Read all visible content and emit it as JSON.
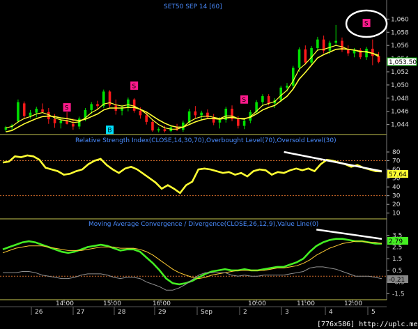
{
  "chart_data": [
    {
      "type": "candlestick",
      "title": "SET50 SEP 14",
      "title_period": "[60]",
      "yticks": [
        "1,060",
        "1,058",
        "1,056",
        "1,054",
        "1,052",
        "1,050",
        "1,048",
        "1,046",
        "1,044"
      ],
      "ylim": [
        1042.8,
        1061.2
      ],
      "last_price_label": "1,053.50",
      "last_price": 1053.5,
      "colors": {
        "up": "#00e000",
        "down": "#ff1a1a",
        "ma": "#ffff33",
        "signal_s": "#ff1a8c",
        "signal_b": "#00e0ff"
      },
      "candles": [
        [
          1043.2,
          1043.8,
          1042.9,
          1043.6
        ],
        [
          1043.6,
          1044.1,
          1043.2,
          1043.9
        ],
        [
          1044.5,
          1047.8,
          1044.2,
          1047.4
        ],
        [
          1047.2,
          1047.5,
          1044.8,
          1045.3
        ],
        [
          1045.3,
          1046.2,
          1044.9,
          1045.8
        ],
        [
          1045.8,
          1046.7,
          1045.1,
          1046.4
        ],
        [
          1046.3,
          1047.2,
          1045.8,
          1045.9
        ],
        [
          1045.9,
          1046.5,
          1044.1,
          1044.8
        ],
        [
          1044.8,
          1045.6,
          1043.5,
          1044.2
        ],
        [
          1044.2,
          1045.1,
          1043.4,
          1044.6
        ],
        [
          1044.6,
          1045.9,
          1044.0,
          1044.1
        ],
        [
          1044.1,
          1044.9,
          1043.2,
          1043.7
        ],
        [
          1043.7,
          1045.2,
          1043.3,
          1044.9
        ],
        [
          1044.9,
          1046.5,
          1044.5,
          1046.2
        ],
        [
          1046.2,
          1047.4,
          1045.6,
          1047.1
        ],
        [
          1047.1,
          1047.6,
          1046.2,
          1046.8
        ],
        [
          1046.8,
          1049.3,
          1046.5,
          1049.0
        ],
        [
          1049.0,
          1049.2,
          1046.6,
          1046.9
        ],
        [
          1046.9,
          1047.8,
          1045.5,
          1046.1
        ],
        [
          1046.1,
          1047.0,
          1045.4,
          1046.6
        ],
        [
          1046.6,
          1048.1,
          1046.0,
          1047.8
        ],
        [
          1047.8,
          1048.0,
          1045.8,
          1046.1
        ],
        [
          1046.1,
          1046.6,
          1044.9,
          1045.4
        ],
        [
          1045.4,
          1045.8,
          1044.0,
          1044.4
        ],
        [
          1044.4,
          1044.8,
          1042.9,
          1043.1
        ],
        [
          1043.1,
          1043.6,
          1042.8,
          1043.3
        ],
        [
          1043.3,
          1043.8,
          1042.8,
          1043.0
        ],
        [
          1043.0,
          1043.9,
          1042.8,
          1043.6
        ],
        [
          1043.6,
          1044.1,
          1043.0,
          1043.2
        ],
        [
          1043.2,
          1044.6,
          1042.9,
          1044.3
        ],
        [
          1044.3,
          1046.4,
          1044.1,
          1046.0
        ],
        [
          1046.0,
          1046.8,
          1045.0,
          1045.4
        ],
        [
          1045.4,
          1046.1,
          1044.6,
          1045.8
        ],
        [
          1045.8,
          1046.3,
          1044.9,
          1045.1
        ],
        [
          1045.1,
          1045.6,
          1043.9,
          1044.3
        ],
        [
          1044.3,
          1045.1,
          1043.4,
          1044.7
        ],
        [
          1044.7,
          1046.7,
          1044.3,
          1046.4
        ],
        [
          1046.4,
          1046.9,
          1044.5,
          1044.8
        ],
        [
          1044.8,
          1045.3,
          1043.4,
          1043.8
        ],
        [
          1043.8,
          1045.0,
          1043.3,
          1044.6
        ],
        [
          1044.6,
          1046.2,
          1044.2,
          1045.9
        ],
        [
          1045.9,
          1047.7,
          1045.6,
          1047.4
        ],
        [
          1047.4,
          1048.6,
          1047.0,
          1048.3
        ],
        [
          1048.3,
          1048.6,
          1046.9,
          1047.2
        ],
        [
          1047.2,
          1048.0,
          1046.5,
          1047.7
        ],
        [
          1047.7,
          1049.9,
          1047.4,
          1049.6
        ],
        [
          1049.6,
          1050.3,
          1049.0,
          1049.9
        ],
        [
          1049.9,
          1052.9,
          1049.5,
          1052.6
        ],
        [
          1052.6,
          1055.7,
          1052.0,
          1055.4
        ],
        [
          1055.4,
          1056.0,
          1053.1,
          1053.4
        ],
        [
          1053.4,
          1055.9,
          1053.0,
          1055.6
        ],
        [
          1055.6,
          1057.3,
          1055.2,
          1056.9
        ],
        [
          1056.9,
          1057.5,
          1054.8,
          1055.2
        ],
        [
          1055.2,
          1056.7,
          1054.7,
          1056.4
        ],
        [
          1056.4,
          1059.1,
          1055.9,
          1056.7
        ],
        [
          1056.7,
          1057.2,
          1055.0,
          1055.3
        ],
        [
          1055.3,
          1056.0,
          1054.4,
          1054.8
        ],
        [
          1054.8,
          1055.6,
          1054.2,
          1055.3
        ],
        [
          1055.3,
          1055.6,
          1053.9,
          1054.2
        ],
        [
          1054.2,
          1055.8,
          1053.8,
          1055.5
        ],
        [
          1055.5,
          1056.9,
          1053.0,
          1054.4
        ],
        [
          1054.4,
          1055.0,
          1053.3,
          1053.5
        ]
      ],
      "ma_fast": [
        1043.5,
        1043.7,
        1044.4,
        1044.9,
        1045.2,
        1045.6,
        1045.8,
        1045.5,
        1045.0,
        1044.7,
        1044.6,
        1044.3,
        1044.4,
        1045.0,
        1045.8,
        1046.3,
        1047.1,
        1047.3,
        1047.0,
        1046.8,
        1047.0,
        1046.8,
        1046.3,
        1045.6,
        1044.7,
        1044.0,
        1043.5,
        1043.3,
        1043.3,
        1043.6,
        1044.4,
        1044.9,
        1045.2,
        1045.3,
        1045.1,
        1044.9,
        1045.3,
        1045.3,
        1044.9,
        1044.8,
        1045.2,
        1046.0,
        1046.9,
        1047.2,
        1047.5,
        1048.4,
        1049.2,
        1050.6,
        1052.4,
        1053.2,
        1054.2,
        1055.3,
        1055.4,
        1055.7,
        1056.0,
        1055.8,
        1055.4,
        1055.3,
        1055.0,
        1055.1,
        1054.8,
        1054.3
      ],
      "ma_slow": [
        1042.9,
        1043.1,
        1043.6,
        1044.1,
        1044.5,
        1044.9,
        1045.2,
        1045.3,
        1045.2,
        1045.0,
        1044.9,
        1044.7,
        1044.6,
        1044.8,
        1045.2,
        1045.6,
        1046.2,
        1046.5,
        1046.5,
        1046.5,
        1046.6,
        1046.6,
        1046.3,
        1045.9,
        1045.3,
        1044.7,
        1044.2,
        1043.8,
        1043.6,
        1043.6,
        1044.0,
        1044.4,
        1044.7,
        1044.9,
        1044.9,
        1044.8,
        1045.0,
        1045.1,
        1044.9,
        1044.9,
        1045.1,
        1045.6,
        1046.2,
        1046.6,
        1046.9,
        1047.6,
        1048.3,
        1049.4,
        1050.9,
        1051.9,
        1053.0,
        1054.1,
        1054.6,
        1055.0,
        1055.4,
        1055.5,
        1055.4,
        1055.3,
        1055.1,
        1055.0,
        1054.8,
        1054.5
      ],
      "signals": [
        {
          "label": "S",
          "candle": 10,
          "price": 1046.6,
          "kind": "sell"
        },
        {
          "label": "S",
          "candle": 21,
          "price": 1049.9,
          "kind": "sell"
        },
        {
          "label": "B",
          "candle": 17,
          "price": 1043.2,
          "kind": "buy"
        },
        {
          "label": "S",
          "candle": 39,
          "price": 1047.8,
          "kind": "sell"
        },
        {
          "label": "S",
          "candle": 59,
          "price": 1059.4,
          "kind": "sell"
        }
      ],
      "highlight_circle_on_signal": 4
    },
    {
      "type": "line",
      "title": "Relative Strength Index(CLOSE,14,30,70),Overbought Level(70),Oversold Level(30)",
      "yticks": [
        "80",
        "70",
        "60",
        "50",
        "40",
        "30",
        "20",
        "10"
      ],
      "ylim": [
        5,
        88
      ],
      "levels": [
        70,
        30
      ],
      "last_value_label": "57.64",
      "last_value": 57.64,
      "series": [
        {
          "values": [
            68,
            69,
            75,
            74,
            76,
            75,
            71,
            62,
            60,
            58,
            54,
            55,
            58,
            60,
            66,
            70,
            72,
            65,
            60,
            56,
            61,
            63,
            60,
            55,
            50,
            45,
            38,
            42,
            38,
            33,
            42,
            46,
            60,
            61,
            60,
            58,
            56,
            57,
            54,
            56,
            52,
            58,
            60,
            59,
            54,
            57,
            56,
            59,
            61,
            59,
            61,
            58,
            66,
            71,
            70,
            68,
            66,
            63,
            65,
            62,
            60,
            58,
            57.64
          ],
          "color": "#ffff33"
        }
      ],
      "trend_line": {
        "from": [
          46,
          80
        ],
        "to": [
          62,
          58
        ],
        "color": "#ffffff"
      }
    },
    {
      "type": "line",
      "title": "Moving Average Convergence / Divergence(CLOSE,26,12,9),Value Line(0)",
      "yticks": [
        "3.5",
        "2.5",
        "1.5",
        "0.5",
        "-0.5",
        "-1.5"
      ],
      "ylim": [
        -1.9,
        4.2
      ],
      "levels": [
        0
      ],
      "last_value_labels": [
        "2.79",
        "-0.21"
      ],
      "series": [
        {
          "values": [
            2.3,
            2.5,
            2.7,
            2.9,
            3.0,
            2.9,
            2.7,
            2.5,
            2.3,
            2.1,
            2.0,
            2.1,
            2.3,
            2.5,
            2.6,
            2.7,
            2.6,
            2.4,
            2.2,
            2.3,
            2.3,
            2.1,
            1.6,
            1.1,
            0.5,
            -0.2,
            -0.6,
            -0.7,
            -0.6,
            -0.4,
            -0.1,
            0.2,
            0.4,
            0.5,
            0.6,
            0.5,
            0.5,
            0.6,
            0.5,
            0.5,
            0.6,
            0.7,
            0.8,
            0.8,
            1.0,
            1.2,
            1.5,
            2.1,
            2.6,
            2.9,
            3.1,
            3.2,
            3.2,
            3.1,
            3.0,
            3.0,
            2.9,
            2.8,
            2.79
          ],
          "color": "#44ee22"
        },
        {
          "values": [
            2.0,
            2.2,
            2.4,
            2.5,
            2.6,
            2.6,
            2.6,
            2.5,
            2.4,
            2.3,
            2.2,
            2.2,
            2.2,
            2.3,
            2.4,
            2.5,
            2.5,
            2.5,
            2.4,
            2.4,
            2.4,
            2.3,
            2.1,
            1.8,
            1.4,
            1.0,
            0.6,
            0.3,
            0.1,
            -0.1,
            -0.2,
            -0.1,
            0.1,
            0.2,
            0.3,
            0.4,
            0.5,
            0.5,
            0.5,
            0.5,
            0.5,
            0.6,
            0.7,
            0.7,
            0.8,
            0.9,
            1.1,
            1.4,
            1.8,
            2.1,
            2.4,
            2.6,
            2.8,
            2.9,
            3.0,
            3.0,
            2.9,
            2.9,
            2.8
          ],
          "color": "#ffcc33"
        },
        {
          "values": [
            0.3,
            0.3,
            0.3,
            0.4,
            0.4,
            0.3,
            0.1,
            0.0,
            -0.1,
            -0.2,
            -0.2,
            -0.1,
            0.1,
            0.2,
            0.2,
            0.2,
            0.1,
            -0.1,
            -0.2,
            -0.1,
            -0.1,
            -0.2,
            -0.5,
            -0.7,
            -0.9,
            -1.2,
            -1.2,
            -1.0,
            -0.7,
            -0.3,
            0.1,
            0.3,
            0.3,
            0.3,
            0.3,
            0.1,
            0.0,
            0.1,
            0.0,
            0.0,
            0.1,
            0.1,
            0.1,
            0.1,
            0.2,
            0.3,
            0.4,
            0.7,
            0.8,
            0.8,
            0.7,
            0.6,
            0.4,
            0.2,
            0.0,
            0.0,
            0.0,
            -0.1,
            -0.21
          ],
          "color": "#909090"
        }
      ],
      "trend_line": {
        "from": [
          48,
          4.0
        ],
        "to": [
          58,
          3.2
        ],
        "color": "#ffffff"
      }
    }
  ],
  "time_axis": {
    "times": [
      "14:00",
      "15:00",
      "16:00",
      "10:00",
      "11:00",
      "12:00"
    ],
    "dates": [
      "26",
      "27",
      "28",
      "29",
      "Sep",
      "2",
      "3",
      "4",
      "5"
    ]
  },
  "watermark": "[776x586] http://uplc.me/"
}
